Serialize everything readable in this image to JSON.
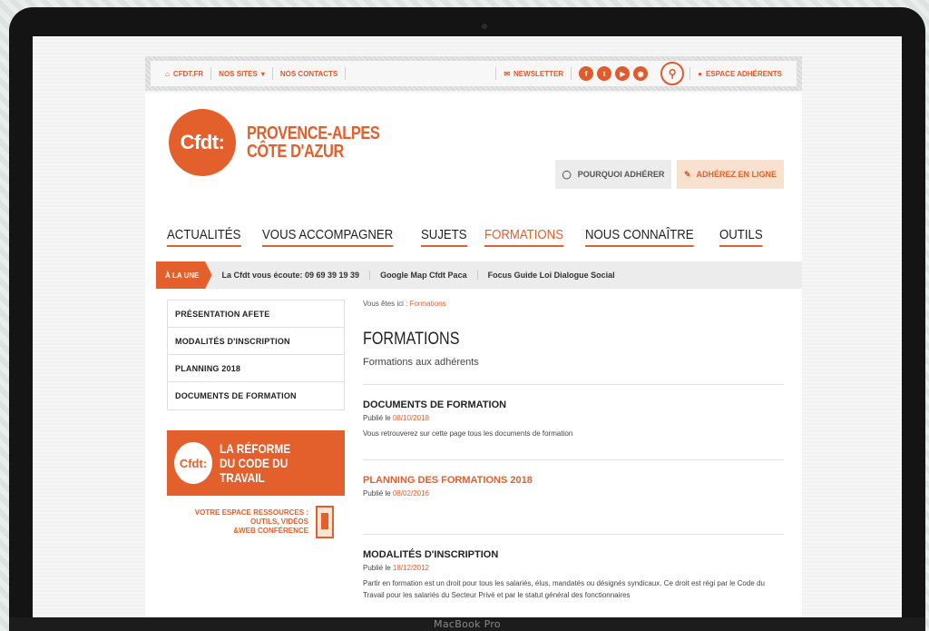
{
  "device_label": "MacBook Pro",
  "utilbar": {
    "home_link": "CFDT.FR",
    "sites_link": "NOS SITES",
    "contacts_link": "NOS CONTACTS",
    "newsletter_link": "NEWSLETTER",
    "social_icons": [
      "facebook-icon",
      "twitter-icon",
      "youtube-icon",
      "rss-icon"
    ],
    "member_link": "ESPACE ADHÉRENTS"
  },
  "header": {
    "logo_text": "Cfdt:",
    "region_line1": "PROVENCE-ALPES",
    "region_line2": "CÔTE D'AZUR",
    "why_join_label": "POURQUOI ADHÉRER",
    "join_online_label": "ADHÉREZ EN LIGNE"
  },
  "mainnav": {
    "items": [
      {
        "label": "ACTUALITÉS"
      },
      {
        "label": "VOUS ACCOMPAGNER"
      },
      {
        "label": "SUJETS"
      },
      {
        "label": "FORMATIONS",
        "active": true
      },
      {
        "label": "NOUS CONNAÎTRE"
      },
      {
        "label": "OUTILS"
      }
    ]
  },
  "alaune": {
    "tag": "À LA UNE",
    "links": [
      "La Cfdt vous écoute: 09 69 39 19 39",
      "Google Map Cfdt Paca",
      "Focus Guide Loi Dialogue Social"
    ]
  },
  "sidemenu": {
    "items": [
      "PRÉSENTATION AFETE",
      "MODALITÉS D'INSCRIPTION",
      "PLANNING 2018",
      "DOCUMENTS DE FORMATION"
    ]
  },
  "promo": {
    "logo_text": "Cfdt:",
    "title_line1": "LA RÉFORME",
    "title_line2": "DU CODE DU TRAVAIL",
    "text_line1": "VOTRE ESPACE RESSOURCES :",
    "text_line2": "OUTILS, VIDÉOS",
    "text_line3": "&WEB CONFÉRENCE"
  },
  "content": {
    "breadcrumb_prefix": "Vous êtes ici : ",
    "breadcrumb_current": "Formations",
    "title": "FORMATIONS",
    "subtitle": "Formations aux adhérents",
    "articles": [
      {
        "title": "DOCUMENTS DE FORMATION",
        "date_prefix": "Publié le ",
        "date": "08/10/2018",
        "text": "Vous retrouverez sur cette page tous les documents de formation"
      },
      {
        "title": "PLANNING DES FORMATIONS 2018",
        "date_prefix": "Publié le ",
        "date": "08/02/2016",
        "text": ""
      },
      {
        "title": "MODALITÉS D'INSCRIPTION",
        "date_prefix": "Publié le ",
        "date": "18/12/2012",
        "text": "Partir en formation est un droit pour tous les salariés, élus, mandatés ou désignés syndicaux. Ce droit est régi par le Code du Travail pour les salariés du Secteur Privé et par le statut général des fonctionnaires"
      }
    ]
  },
  "colors": {
    "accent": "#e35f2c",
    "bezel": "#141414"
  }
}
